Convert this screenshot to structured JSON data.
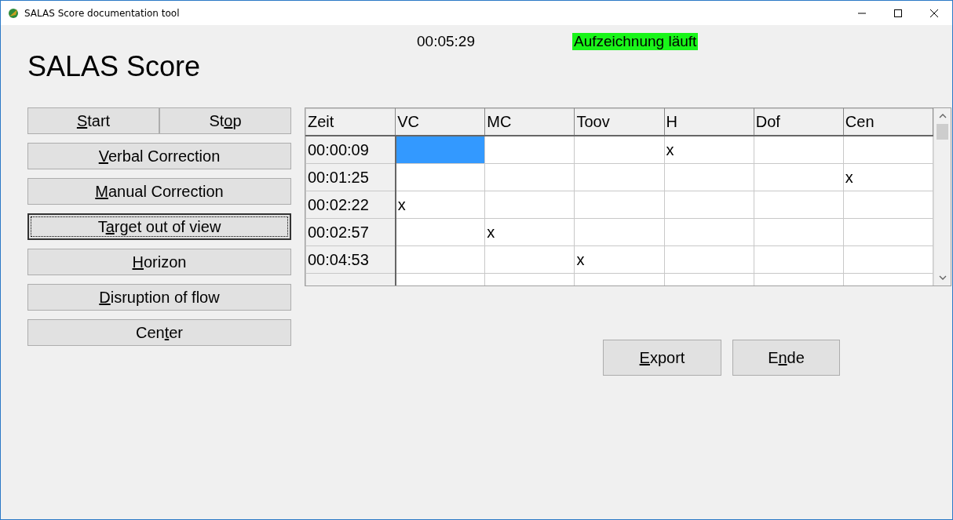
{
  "window": {
    "title": "SALAS Score documentation tool"
  },
  "header": {
    "title": "SALAS Score",
    "elapsed": "00:05:29",
    "status": "Aufzeichnung läuft",
    "recording": true
  },
  "buttons": [
    {
      "key": "S",
      "post": "tart",
      "focused": false
    },
    {
      "pre": "St",
      "key": "o",
      "post": "p",
      "focused": false
    },
    {
      "key": "V",
      "post": "erbal Correction",
      "focused": false
    },
    {
      "key": "M",
      "post": "anual Correction",
      "focused": false
    },
    {
      "pre": "T",
      "key": "a",
      "post": "rget out of view",
      "focused": true
    },
    {
      "key": "H",
      "post": "orizon",
      "focused": false
    },
    {
      "key": "D",
      "post": "isruption of flow",
      "focused": false
    },
    {
      "pre": "Cen",
      "key": "t",
      "post": "er",
      "focused": false
    }
  ],
  "table": {
    "columns": [
      "Zeit",
      "VC",
      "MC",
      "Toov",
      "H",
      "Dof",
      "Cen"
    ],
    "rows": [
      {
        "cells": [
          "00:00:09",
          "",
          "",
          "",
          "x",
          "",
          ""
        ],
        "cell_selected": [
          false,
          true,
          false,
          false,
          false,
          false,
          false
        ]
      },
      {
        "cells": [
          "00:01:25",
          "",
          "",
          "",
          "",
          "",
          "x"
        ],
        "cell_selected": [
          false,
          false,
          false,
          false,
          false,
          false,
          false
        ]
      },
      {
        "cells": [
          "00:02:22",
          "x",
          "",
          "",
          "",
          "",
          ""
        ],
        "cell_selected": [
          false,
          false,
          false,
          false,
          false,
          false,
          false
        ]
      },
      {
        "cells": [
          "00:02:57",
          "",
          "x",
          "",
          "",
          "",
          ""
        ],
        "cell_selected": [
          false,
          false,
          false,
          false,
          false,
          false,
          false
        ]
      },
      {
        "cells": [
          "00:04:53",
          "",
          "",
          "x",
          "",
          "",
          ""
        ],
        "cell_selected": [
          false,
          false,
          false,
          false,
          false,
          false,
          false
        ]
      }
    ]
  },
  "actions": [
    {
      "key": "E",
      "post": "xport",
      "focused": false
    },
    {
      "pre": "E",
      "key": "n",
      "post": "de",
      "focused": false
    }
  ]
}
